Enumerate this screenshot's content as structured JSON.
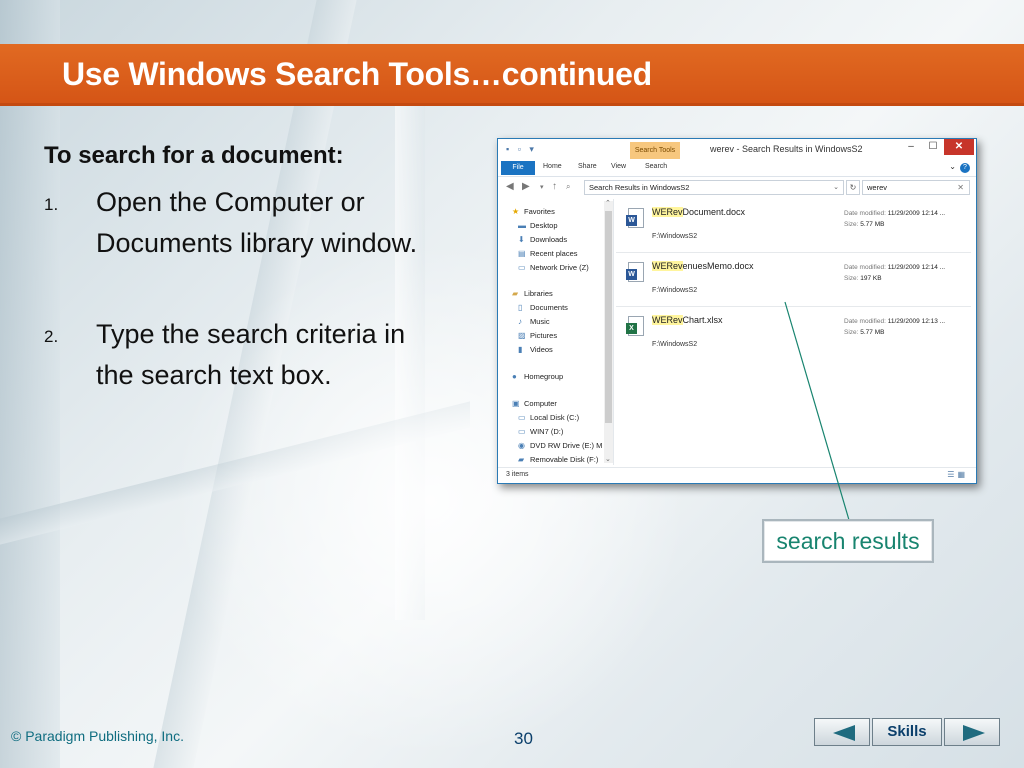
{
  "slide": {
    "title": "Use Windows Search Tools…continued",
    "subheading": "To search for a document:",
    "steps": [
      {
        "num": "1.",
        "text": "Open the Computer or Documents library window."
      },
      {
        "num": "2.",
        "text": "Type the search criteria in the search text box."
      }
    ],
    "callout": "search results",
    "copyright": "© Paradigm Publishing, Inc.",
    "page_number": "30",
    "nav": {
      "skills_label": "Skills"
    }
  },
  "explorer": {
    "contextual_tab": "Search Tools",
    "window_title": "werev - Search Results in WindowsS2",
    "ribbon_tabs": [
      "File",
      "Home",
      "Share",
      "View",
      "Search"
    ],
    "address_path": "Search Results in WindowsS2",
    "search_query": "werev",
    "nav_pane": {
      "favorites_header": "Favorites",
      "favorites": [
        "Desktop",
        "Downloads",
        "Recent places",
        "Network Drive (Z)"
      ],
      "libraries_header": "Libraries",
      "libraries": [
        "Documents",
        "Music",
        "Pictures",
        "Videos"
      ],
      "homegroup": "Homegroup",
      "computer_header": "Computer",
      "drives": [
        "Local Disk (C:)",
        "WIN7 (D:)",
        "DVD RW Drive (E:) M",
        "Removable Disk (F:)"
      ]
    },
    "results": [
      {
        "match": "WERev",
        "rest": "Document.docx",
        "type": "word",
        "path": "F:\\WindowsS2",
        "date_label": "Date modified:",
        "date": "11/29/2009 12:14 ...",
        "size_label": "Size:",
        "size": "5.77 MB"
      },
      {
        "match": "WERev",
        "rest": "enuesMemo.docx",
        "type": "word",
        "path": "F:\\WindowsS2",
        "date_label": "Date modified:",
        "date": "11/29/2009 12:14 ...",
        "size_label": "Size:",
        "size": "197 KB"
      },
      {
        "match": "WERev",
        "rest": "Chart.xlsx",
        "type": "excel",
        "path": "F:\\WindowsS2",
        "date_label": "Date modified:",
        "date": "11/29/2009 12:13 ...",
        "size_label": "Size:",
        "size": "5.77 MB"
      }
    ],
    "status": "3 items"
  },
  "colors": {
    "title_bar": "#d95b1a",
    "callout_text": "#18846f",
    "footer_text": "#0f6d80",
    "file_tab": "#1a73c2"
  }
}
